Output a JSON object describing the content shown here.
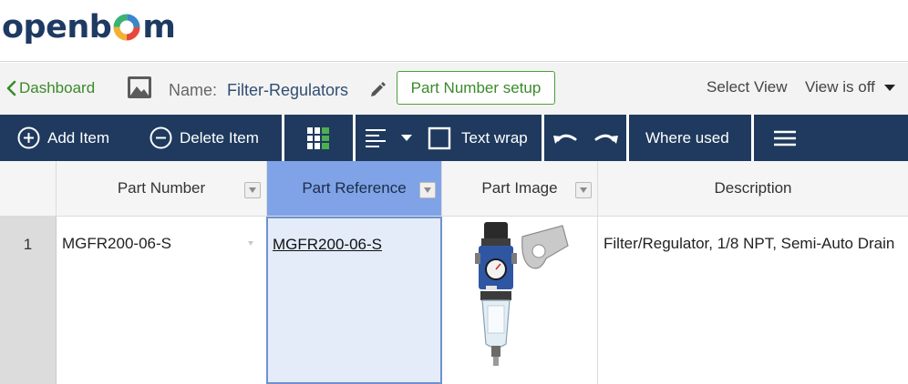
{
  "brand": {
    "logo_text_left": "openb",
    "logo_text_right": "m"
  },
  "header": {
    "back_label": "Dashboard",
    "name_label": "Name:",
    "name_value": "Filter-Regulators",
    "part_number_setup": "Part Number setup",
    "select_view": "Select View",
    "view_status": "View is off"
  },
  "toolbar": {
    "add_item": "Add Item",
    "delete_item": "Delete Item",
    "text_wrap": "Text wrap",
    "where_used": "Where used"
  },
  "table": {
    "columns": [
      "Part Number",
      "Part Reference",
      "Part Image",
      "Description"
    ],
    "rows": [
      {
        "num": "1",
        "part_number": "MGFR200-06-S",
        "part_reference": "MGFR200-06-S",
        "part_image": "filter-regulator-image",
        "description": "Filter/Regulator, 1/8 NPT, Semi-Auto Drain"
      }
    ]
  },
  "colors": {
    "toolbar_bg": "#1f3a5e",
    "accent_green": "#3a8a2a",
    "selected_header": "#7fa3e6",
    "selected_cell": "#e4ecfa"
  },
  "icons": [
    "image-icon",
    "pencil-icon",
    "chevron-left-icon",
    "plus-circle-icon",
    "minus-circle-icon",
    "grid-view-icon",
    "align-left-icon",
    "caret-down-icon",
    "checkbox-icon",
    "undo-icon",
    "redo-icon",
    "menu-icon"
  ]
}
